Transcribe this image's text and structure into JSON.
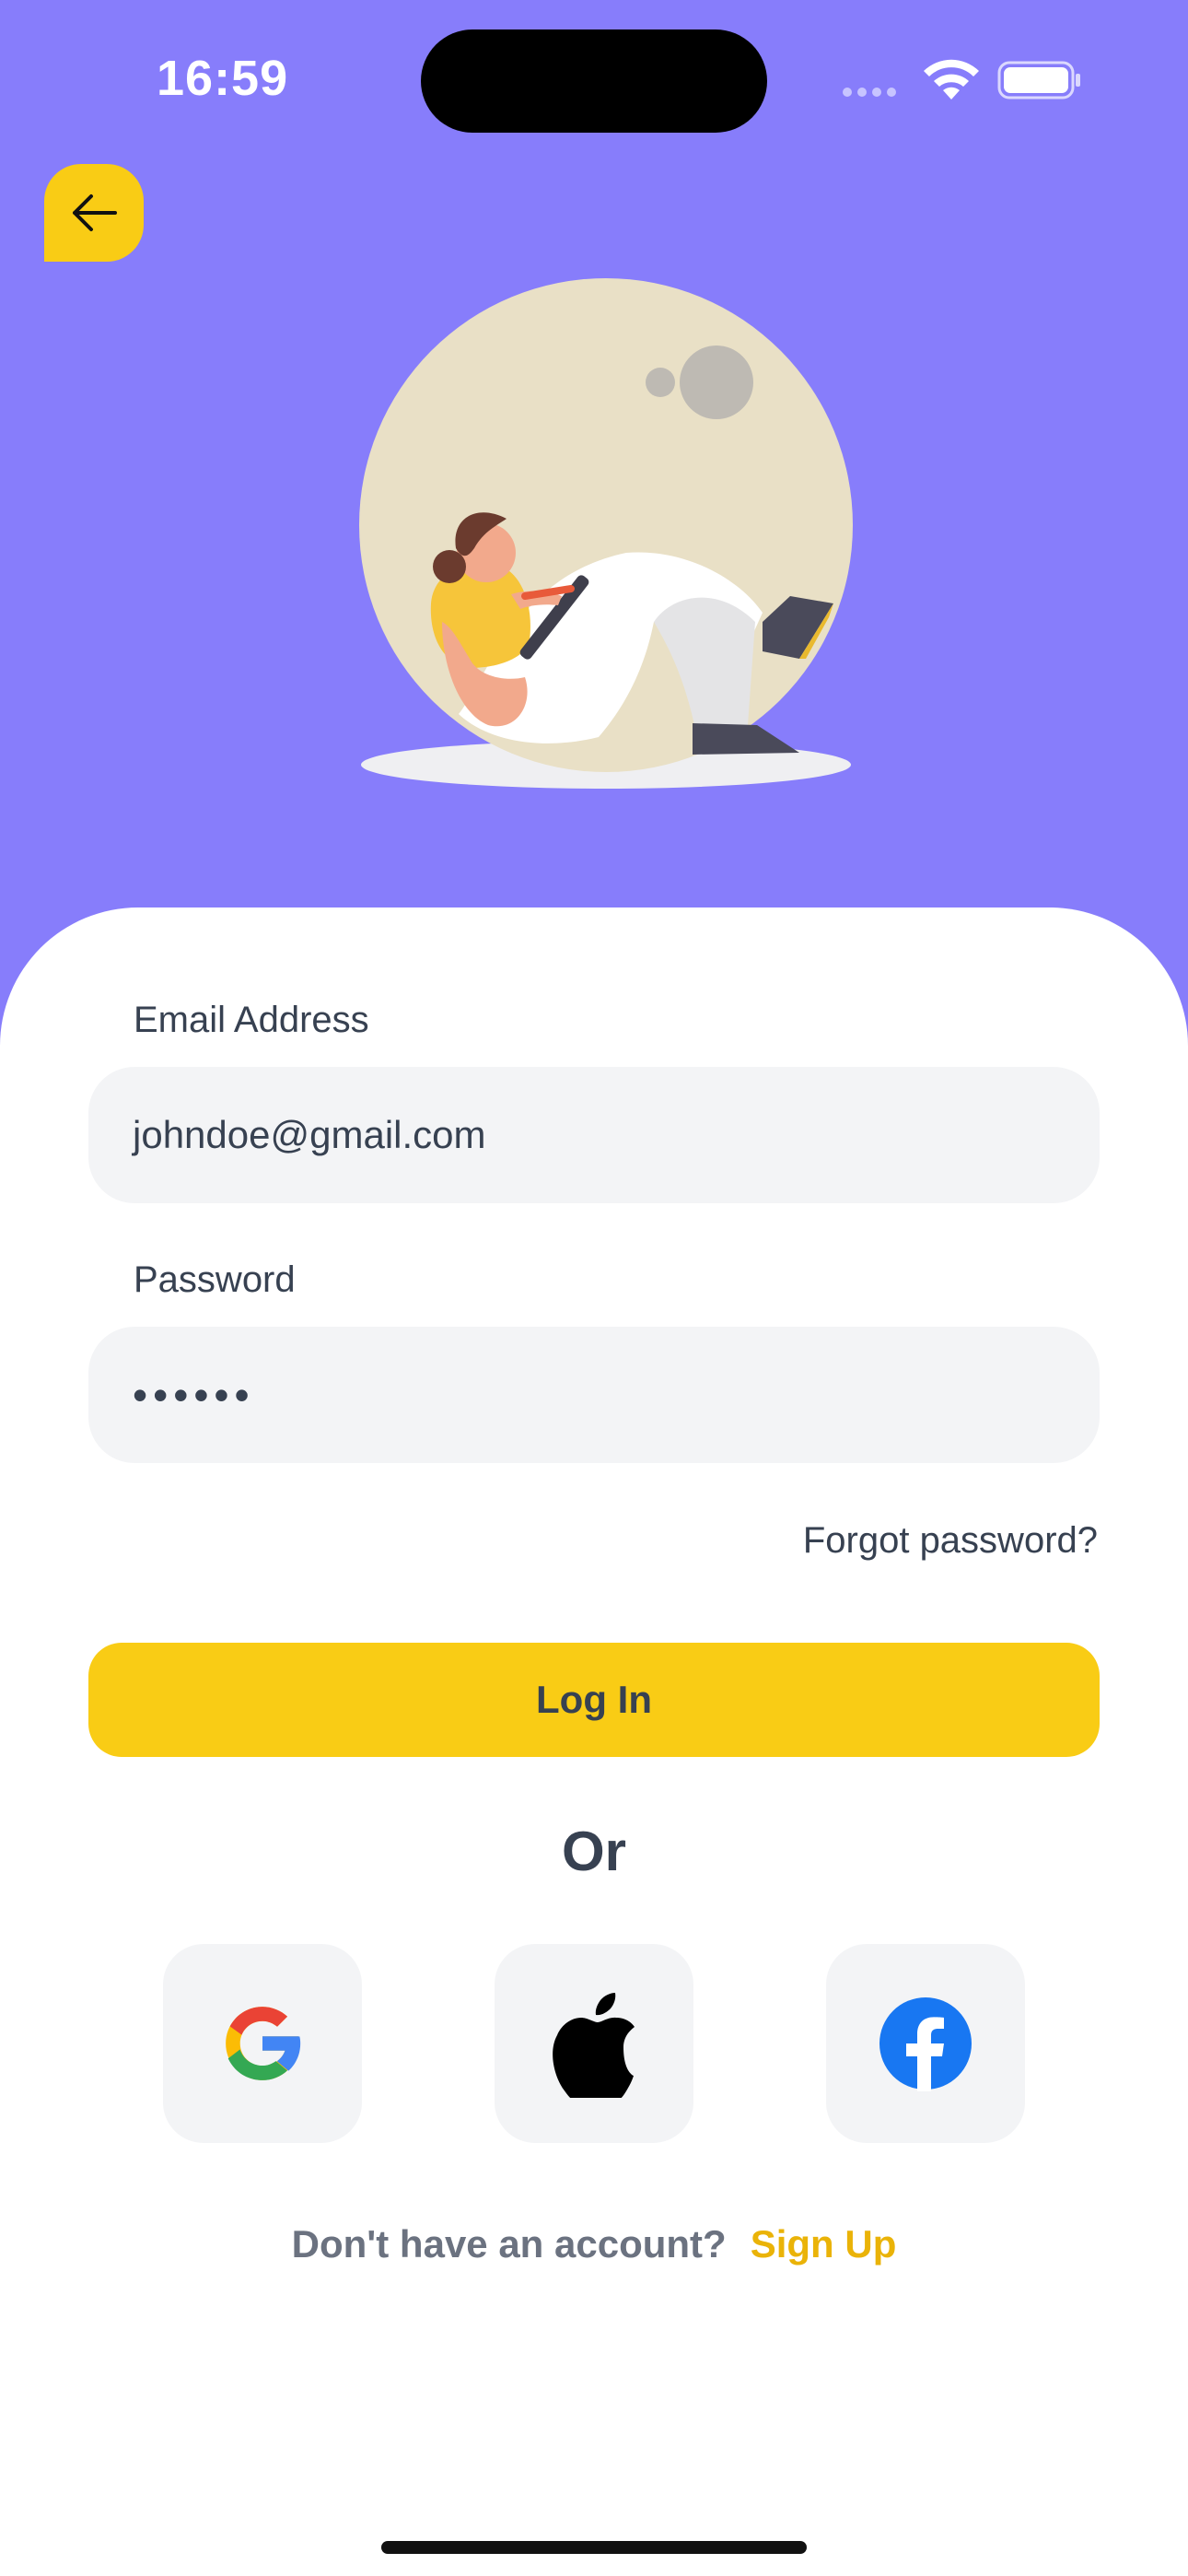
{
  "status_bar": {
    "time": "16:59"
  },
  "back": {
    "icon": "arrow-left-icon"
  },
  "form": {
    "email_label": "Email Address",
    "email_value": "johndoe@gmail.com",
    "password_label": "Password",
    "password_value": "••••••",
    "forgot_password": "Forgot password?",
    "login_label": "Log In",
    "or_label": "Or"
  },
  "social": [
    {
      "icon": "google-icon"
    },
    {
      "icon": "apple-icon"
    },
    {
      "icon": "facebook-icon"
    }
  ],
  "footer": {
    "prompt": "Don't have an account?",
    "signup": "Sign Up"
  },
  "colors": {
    "background": "#877DFB",
    "accent": "#F9CC15",
    "field": "#F3F4F6",
    "link": "#EAB308"
  }
}
